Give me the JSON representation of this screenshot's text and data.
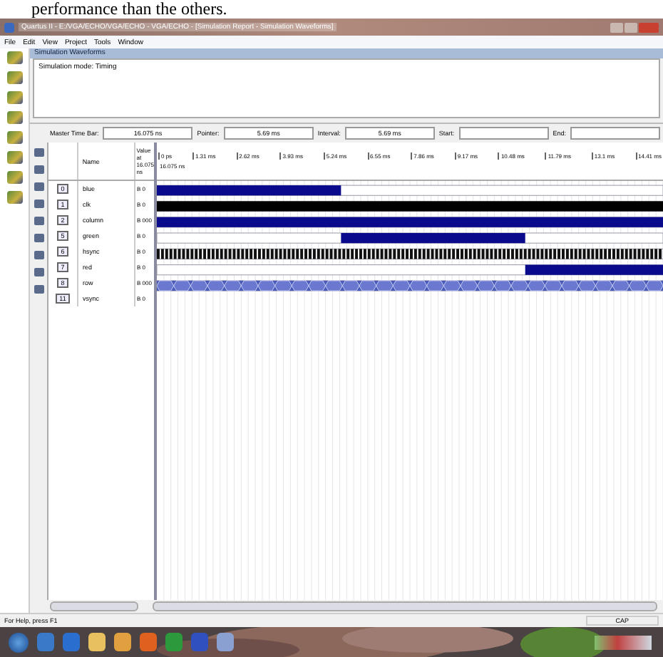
{
  "document_text": "performance than the others.",
  "window": {
    "title": "Quartus II - E:/VGA/ECHO/VGA/ECHO - VGA/ECHO - [Simulation Report - Simulation Waveforms]"
  },
  "menu": [
    "File",
    "Edit",
    "View",
    "Project",
    "Tools",
    "Window"
  ],
  "report": {
    "heading": "Simulation Waveforms",
    "mode": "Simulation mode: Timing"
  },
  "time_bar": [
    {
      "label": "Master Time Bar:",
      "value": "16.075 ns"
    },
    {
      "label": "Pointer:",
      "value": "5.69 ms"
    },
    {
      "label": "Interval:",
      "value": "5.69 ms"
    },
    {
      "label": "Start:"
    },
    {
      "label": "End:"
    }
  ],
  "columns": {
    "name": "Name",
    "value": "Value at 16.075 ns"
  },
  "ruler": {
    "marker": "16.075 ns",
    "ticks": [
      "0 ps",
      "1.31 ms",
      "2.62 ms",
      "3.93 ms",
      "5.24 ms",
      "6.55 ms",
      "7.86 ms",
      "9.17 ms",
      "10.48 ms",
      "11.79 ms",
      "13.1 ms",
      "14.41 ms"
    ]
  },
  "signals": [
    {
      "index": "0",
      "name": "blue",
      "value": "B 0",
      "kind": "high_then_low"
    },
    {
      "index": "1",
      "name": "clk",
      "value": "B 0",
      "kind": "solid"
    },
    {
      "index": "2",
      "name": "column",
      "value": "B 000",
      "kind": "high"
    },
    {
      "index": "5",
      "name": "green",
      "value": "B 0",
      "kind": "low_high_low"
    },
    {
      "index": "6",
      "name": "hsync",
      "value": "B 0",
      "kind": "clock"
    },
    {
      "index": "7",
      "name": "red",
      "value": "B 0",
      "kind": "low_then_high"
    },
    {
      "index": "8",
      "name": "row",
      "value": "B 000",
      "kind": "bus"
    },
    {
      "index": "11",
      "name": "vsync",
      "value": "B 0",
      "kind": "none"
    }
  ],
  "status_bar": {
    "help": "For Help, press F1",
    "caps": "CAP"
  }
}
